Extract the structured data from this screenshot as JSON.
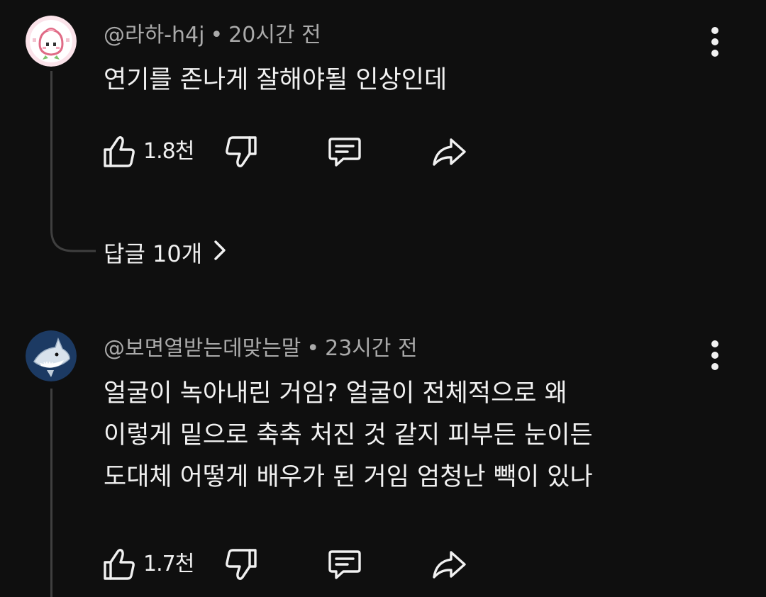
{
  "comments": [
    {
      "author": "@라하-h4j",
      "separator": "•",
      "time": "20시간 전",
      "text_lines": [
        "연기를 존나게 잘해야될 인상인데"
      ],
      "like_count": "1.8천",
      "replies_label": "답글 10개",
      "avatar_icon": "peach-character-icon"
    },
    {
      "author": "@보면열받는데맞는말",
      "separator": "•",
      "time": "23시간 전",
      "text_lines": [
        "얼굴이 녹아내린 거임? 얼굴이 전체적으로 왜",
        "이렇게 밑으로 축축 처진 것 같지 피부든 눈이든",
        "도대체 어떻게 배우가 된 거임 엄청난 빽이 있나"
      ],
      "like_count": "1.7천",
      "avatar_icon": "shark-icon"
    }
  ],
  "colors": {
    "background": "#0f0f0f",
    "primary_text": "#f1f1f1",
    "secondary_text": "#aaaaaa",
    "thread_line": "#3f3f3f"
  }
}
